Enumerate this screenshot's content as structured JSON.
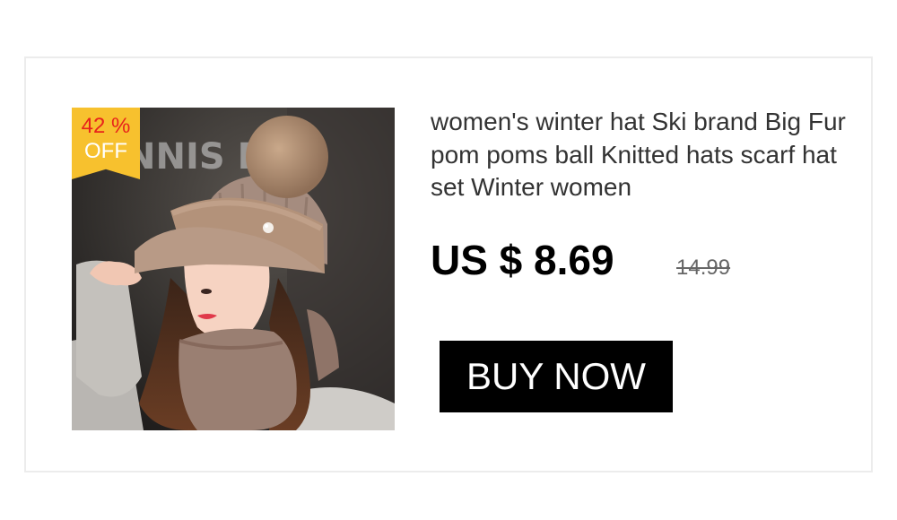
{
  "product": {
    "discount_percent": "42 %",
    "discount_off": "OFF",
    "title": "women's winter hat Ski brand Big Fur pom poms ball Knitted hats scarf hat set Winter women",
    "price": "US $ 8.69",
    "original_price": "14.99",
    "buy_button_label": "BUY NOW",
    "image_backdrop_text": "NNIS ETIS"
  },
  "colors": {
    "badge_background": "#f7c12e",
    "badge_percent_text": "#e8231b",
    "button_background": "#000000",
    "button_text": "#ffffff"
  }
}
